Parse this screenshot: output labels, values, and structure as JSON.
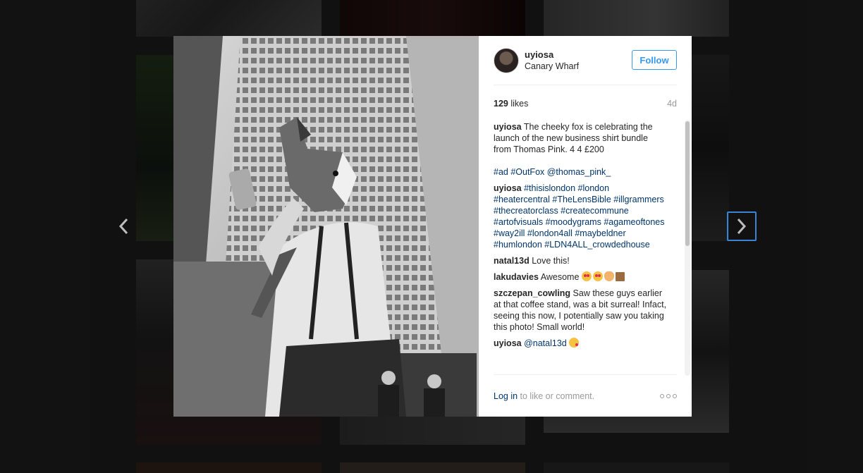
{
  "navigation": {
    "prev_icon": "chevron-left-icon",
    "next_icon": "chevron-right-icon"
  },
  "post": {
    "username": "uyiosa",
    "location": "Canary Wharf",
    "follow_label": "Follow",
    "likes_count": "129",
    "likes_word": "likes",
    "age": "4d",
    "photo_description_icon": "fox-mask-photo"
  },
  "comments": [
    {
      "author": "uyiosa",
      "text": "The cheeky fox is celebrating the launch of the new business shirt bundle from Thomas Pink. 4 4 £200"
    },
    {
      "author": "",
      "tags": "#ad #OutFox @thomas_pink_"
    },
    {
      "author": "uyiosa",
      "tags": "#thisislondon #london #heatercentral #TheLensBible #illgrammers #thecreatorclass #createcommune #artofvisuals #moodygrams #agameoftones #way2ill #london4all #maybeldner #humlondon #LDN4ALL_crowdedhouse"
    },
    {
      "author": "natal13d",
      "text": "Love this!"
    },
    {
      "author": "lakudavies",
      "text": "Awesome"
    },
    {
      "author": "szczepan_cowling",
      "text": "Saw these guys earlier at that coffee stand, was a bit surreal! Infact, seeing this now, I potentially saw you taking this photo! Small world!"
    },
    {
      "author": "uyiosa",
      "mention": "@natal13d"
    }
  ],
  "footer": {
    "login_label": "Log in",
    "rest_label": " to like or comment."
  },
  "colors": {
    "accent": "#3897f0",
    "link": "#003569",
    "focus": "#3b83d4"
  }
}
